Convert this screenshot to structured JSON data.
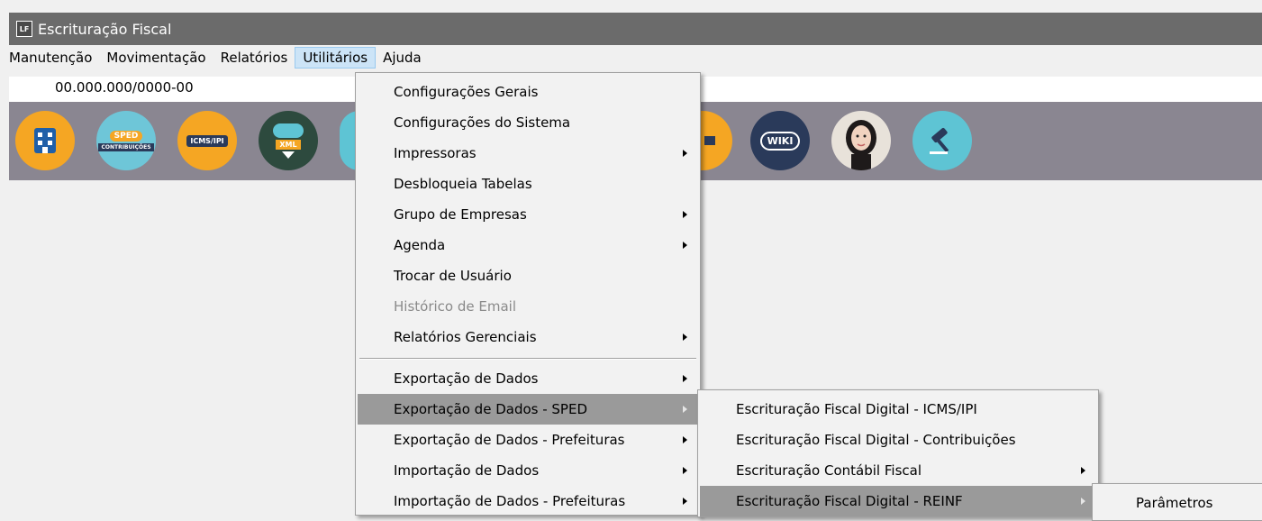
{
  "window": {
    "title": "Escrituração Fiscal",
    "logo": "LF"
  },
  "menubar": {
    "items": [
      {
        "label": "Manutenção"
      },
      {
        "label": "Movimentação"
      },
      {
        "label": "Relatórios"
      },
      {
        "label": "Utilitários"
      },
      {
        "label": "Ajuda"
      }
    ]
  },
  "company": {
    "cnpj": "00.000.000/0000-00"
  },
  "toolbar": {
    "icons": [
      {
        "name": "company-icon",
        "color": "#f5a623"
      },
      {
        "name": "sped-contribuicoes-icon",
        "text1": "SPED",
        "text2": "CONTRIBUIÇÕES",
        "color": "#6ec6d8"
      },
      {
        "name": "icms-ipi-icon",
        "text": "ICMS/IPI",
        "color": "#f5a623"
      },
      {
        "name": "xml-download-icon",
        "text": "XML",
        "color": "#2d4a3e"
      },
      {
        "name": "chat-icon",
        "color": "#f5a623"
      },
      {
        "name": "wiki-icon",
        "text": "WIKI",
        "color": "#2a3a5a"
      },
      {
        "name": "assistant-avatar-icon",
        "color": "#e0e0e0"
      },
      {
        "name": "gavel-icon",
        "color": "#5ec4d4"
      }
    ]
  },
  "utilitarios_menu": {
    "items": [
      {
        "label": "Configurações Gerais",
        "submenu": false
      },
      {
        "label": "Configurações do Sistema",
        "submenu": false
      },
      {
        "label": "Impressoras",
        "submenu": true
      },
      {
        "label": "Desbloqueia Tabelas",
        "submenu": false
      },
      {
        "label": "Grupo de Empresas",
        "submenu": true
      },
      {
        "label": "Agenda",
        "submenu": true
      },
      {
        "label": "Trocar de Usuário",
        "submenu": false
      },
      {
        "label": "Histórico de Email",
        "submenu": false,
        "disabled": true
      },
      {
        "label": "Relatórios Gerenciais",
        "submenu": true
      },
      {
        "label": "Exportação de Dados",
        "submenu": true
      },
      {
        "label": "Exportação de Dados - SPED",
        "submenu": true,
        "highlighted": true
      },
      {
        "label": "Exportação de Dados - Prefeituras",
        "submenu": true
      },
      {
        "label": "Importação de Dados",
        "submenu": true
      },
      {
        "label": "Importação de Dados - Prefeituras",
        "submenu": true
      }
    ]
  },
  "sped_submenu": {
    "items": [
      {
        "label": "Escrituração Fiscal Digital - ICMS/IPI",
        "submenu": false
      },
      {
        "label": "Escrituração Fiscal Digital - Contribuições",
        "submenu": false
      },
      {
        "label": "Escrituração Contábil Fiscal",
        "submenu": true
      },
      {
        "label": "Escrituração Fiscal Digital - REINF",
        "submenu": true,
        "highlighted": true
      }
    ]
  },
  "reinf_submenu": {
    "items": [
      {
        "label": "Parâmetros"
      }
    ]
  }
}
